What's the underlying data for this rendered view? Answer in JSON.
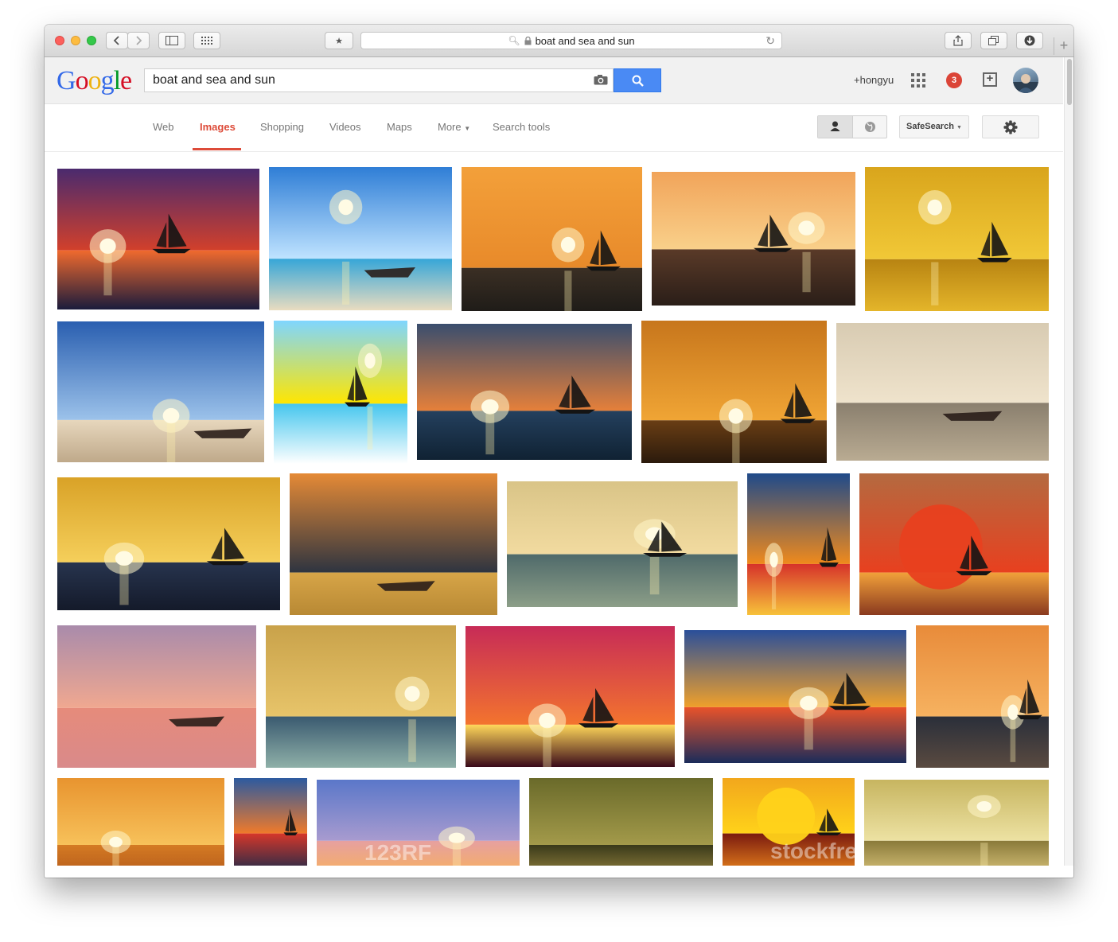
{
  "browser": {
    "url_text": "boat and sea and sun",
    "new_tab_glyph": "+"
  },
  "google": {
    "logo_letters": [
      {
        "char": "G",
        "color": "#3369e8"
      },
      {
        "char": "o",
        "color": "#d50f25"
      },
      {
        "char": "o",
        "color": "#eeb211"
      },
      {
        "char": "g",
        "color": "#3369e8"
      },
      {
        "char": "l",
        "color": "#009925"
      },
      {
        "char": "e",
        "color": "#d50f25"
      }
    ],
    "query": "boat and sea and sun",
    "user": "+hongyu",
    "notifications": "3"
  },
  "nav": {
    "web": "Web",
    "images": "Images",
    "shopping": "Shopping",
    "videos": "Videos",
    "maps": "Maps",
    "more": "More",
    "search_tools": "Search tools",
    "safesearch": "SafeSearch"
  },
  "results": {
    "watermarks": [
      "123RF",
      "stockfresh"
    ],
    "images": [
      {
        "row": 1,
        "scene": "red-purple sunset sky, sailboat silhouette",
        "colors": [
          "#4a2a6e",
          "#d2402b",
          "#f06a2e",
          "#1a1b3c"
        ],
        "boat": "sail",
        "sun": "low"
      },
      {
        "row": 1,
        "scene": "blue sea, bright sun, white boat on sand",
        "colors": [
          "#2f7ed6",
          "#bfe3ff",
          "#36a6d8",
          "#e9dcc0"
        ],
        "boat": "rowboat",
        "sun": "high"
      },
      {
        "row": 1,
        "scene": "orange sky, dark sea, sailboat",
        "colors": [
          "#f3a03a",
          "#e88a2a",
          "#3b2f24",
          "#1f1c18"
        ],
        "boat": "sail",
        "sun": "mid"
      },
      {
        "row": 1,
        "scene": "pale orange sunset, calm sea, small sailboat",
        "colors": [
          "#f1a45a",
          "#f9d08a",
          "#5a3a28",
          "#2a1e18"
        ],
        "boat": "sail",
        "sun": "mid"
      },
      {
        "row": 1,
        "scene": "golden yellow haze, sailboat",
        "colors": [
          "#d9a51c",
          "#f1c837",
          "#b88412",
          "#e4b52a"
        ],
        "boat": "sail",
        "sun": "high"
      },
      {
        "row": 2,
        "scene": "beach, blue sky with clouds, rowboat",
        "colors": [
          "#2a5fb0",
          "#9cc2ea",
          "#e7d7bd",
          "#bfa98a"
        ],
        "boat": "rowboat",
        "sun": "low"
      },
      {
        "row": 2,
        "scene": "cartoon yellow sun rays, black sailboat, cyan sea",
        "colors": [
          "#7fd6ff",
          "#ffe600",
          "#45c6ee",
          "#ffffff"
        ],
        "boat": "sail",
        "sun": "high"
      },
      {
        "row": 2,
        "scene": "dusky orange horizon, blue water, sailboat",
        "colors": [
          "#3a4e6e",
          "#e6803a",
          "#24405e",
          "#102233"
        ],
        "boat": "sail",
        "sun": "low"
      },
      {
        "row": 2,
        "scene": "deep orange sky, sun on horizon",
        "colors": [
          "#c7761c",
          "#f0a535",
          "#6a3e14",
          "#2b1a0c"
        ],
        "boat": "sail",
        "sun": "low"
      },
      {
        "row": 2,
        "scene": "hazy beige bay with island and boat",
        "colors": [
          "#d8cbb2",
          "#efe3cc",
          "#8a7f6e",
          "#b9ab92"
        ],
        "boat": "rowboat",
        "sun": "none"
      },
      {
        "row": 3,
        "scene": "golden sky, dark blue sea, sailboat",
        "colors": [
          "#d9a227",
          "#f5cf5b",
          "#27344e",
          "#141a2a"
        ],
        "boat": "sail",
        "sun": "low"
      },
      {
        "row": 3,
        "scene": "orange sky, person in canoe",
        "colors": [
          "#e58a36",
          "#2e3440",
          "#d7a548",
          "#b88934"
        ],
        "boat": "rowboat",
        "sun": "none"
      },
      {
        "row": 3,
        "scene": "painted golden sea with waves",
        "colors": [
          "#d9c487",
          "#f2dba0",
          "#4f6a6a",
          "#8c9e88"
        ],
        "boat": "sail",
        "sun": "mid"
      },
      {
        "row": 3,
        "scene": "colorful painting, sailboat, red sky",
        "colors": [
          "#1f4a8a",
          "#f08a1c",
          "#d6322a",
          "#f7c23a"
        ],
        "boat": "sail",
        "sun": "low"
      },
      {
        "row": 3,
        "scene": "big red sun, yellow-red sail",
        "colors": [
          "#b46a40",
          "#e8401f",
          "#f2a13a",
          "#8a3a1f"
        ],
        "boat": "sail",
        "sun": "big"
      },
      {
        "row": 4,
        "scene": "pastel pink sunset, calm sea, small boat",
        "colors": [
          "#a98bab",
          "#f0a890",
          "#e68b7b",
          "#d98a8a"
        ],
        "boat": "rowboat",
        "sun": "none"
      },
      {
        "row": 4,
        "scene": "painted stormy waves with golden light",
        "colors": [
          "#c9a24a",
          "#e7c46a",
          "#3a5a70",
          "#8fb0a8"
        ],
        "boat": "none",
        "sun": "mid"
      },
      {
        "row": 4,
        "scene": "magenta sunset with palm tree silhouettes",
        "colors": [
          "#c72b57",
          "#f3742e",
          "#ffd85a",
          "#3a0a1a"
        ],
        "boat": "sail",
        "sun": "low"
      },
      {
        "row": 4,
        "scene": "vivid painted coast, sailboats",
        "colors": [
          "#2a4f9a",
          "#f0a02a",
          "#e9532a",
          "#1b2c5a"
        ],
        "boat": "sail",
        "sun": "low"
      },
      {
        "row": 4,
        "scene": "orange sky, catamaran, sun on horizon",
        "colors": [
          "#e88b3a",
          "#f6b260",
          "#2a2f3a",
          "#5a4a40"
        ],
        "boat": "sail",
        "sun": "low"
      },
      {
        "row": 5,
        "scene": "orange sunset glow over sea",
        "colors": [
          "#e8942f",
          "#f7c15a",
          "#d47a23",
          "#b85e1c"
        ],
        "boat": "none",
        "sun": "low"
      },
      {
        "row": 5,
        "scene": "painted sailboat, dramatic sky",
        "colors": [
          "#2c5aa0",
          "#f07a2a",
          "#d6372a",
          "#1a2a4a"
        ],
        "boat": "sail",
        "sun": "none"
      },
      {
        "row": 5,
        "scene": "blue-purple sky, sun on horizon, 123RF watermark",
        "colors": [
          "#5a77c9",
          "#a89bcf",
          "#e6a0a0",
          "#f7b060"
        ],
        "boat": "none",
        "sun": "low"
      },
      {
        "row": 5,
        "scene": "olive abstract painting",
        "colors": [
          "#6a6a2a",
          "#a39a4a",
          "#3a3a1a",
          "#8a7a3a"
        ],
        "boat": "none",
        "sun": "none"
      },
      {
        "row": 5,
        "scene": "yellow sun, dark red sail, stockfresh watermark",
        "colors": [
          "#f2a71c",
          "#ffd21a",
          "#7a1a0f",
          "#e8831c"
        ],
        "boat": "sail",
        "sun": "big"
      },
      {
        "row": 5,
        "scene": "golden clouds with sun rays",
        "colors": [
          "#c7b560",
          "#ede2a3",
          "#8a7a3a",
          "#d8c37a"
        ],
        "boat": "none",
        "sun": "high"
      }
    ]
  }
}
